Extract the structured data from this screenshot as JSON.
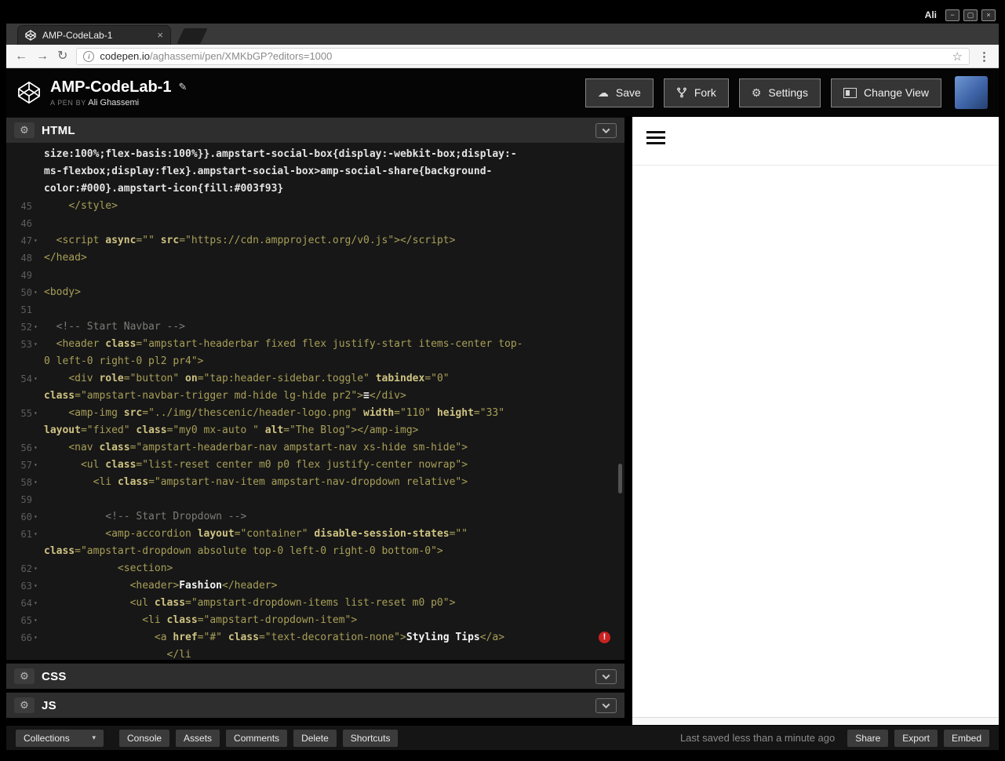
{
  "os": {
    "user": "Ali"
  },
  "icons": {
    "back": "←",
    "forward": "→",
    "reload": "↻",
    "info": "i",
    "star": "☆",
    "menu": "⋮",
    "close_tab": "×",
    "pencil": "✎",
    "gear": "⚙",
    "save_cloud": "☁",
    "caret_down": "▾",
    "error": "!",
    "minimize": "−",
    "maximize": "▢",
    "close": "×"
  },
  "browser": {
    "tab_title": "AMP-CodeLab-1",
    "url_host": "codepen.io",
    "url_path": "/aghassemi/pen/XMKbGP?editors=1000"
  },
  "header": {
    "title": "AMP-CodeLab-1",
    "byline_prefix": "A PEN BY",
    "author": "Ali Ghassemi",
    "buttons": [
      {
        "label": "Save"
      },
      {
        "label": "Fork"
      },
      {
        "label": "Settings"
      },
      {
        "label": "Change View"
      }
    ]
  },
  "editor": {
    "panels": {
      "html": "HTML",
      "css": "CSS",
      "js": "JS"
    },
    "rows": [
      {
        "segs": [
          [
            "pl",
            "size:100%;flex-basis:100%}}.ampstart-social-box{display:-webkit-box;display:-"
          ]
        ]
      },
      {
        "segs": [
          [
            "pl",
            "ms-flexbox;display:flex}.ampstart-social-box>amp-social-share{background-"
          ]
        ]
      },
      {
        "segs": [
          [
            "pl",
            "color:#000}.ampstart-icon{fill:#003f93}"
          ]
        ]
      },
      {
        "n": "45",
        "segs": [
          [
            "pl",
            "    "
          ],
          [
            "tg",
            "</style>"
          ]
        ]
      },
      {
        "n": "46",
        "segs": []
      },
      {
        "n": "47",
        "fold": true,
        "segs": [
          [
            "pl",
            "  "
          ],
          [
            "tg",
            "<script "
          ],
          [
            "at",
            "async"
          ],
          [
            "st",
            "=\"\" "
          ],
          [
            "at",
            "src"
          ],
          [
            "st",
            "=\"https://cdn.ampproject.org/v0.js\""
          ],
          [
            "tg",
            "></script>"
          ]
        ]
      },
      {
        "n": "48",
        "segs": [
          [
            "tg",
            "</head>"
          ]
        ]
      },
      {
        "n": "49",
        "segs": []
      },
      {
        "n": "50",
        "fold": true,
        "segs": [
          [
            "tg",
            "<body>"
          ]
        ]
      },
      {
        "n": "51",
        "segs": []
      },
      {
        "n": "52",
        "fold": true,
        "segs": [
          [
            "cm",
            "  <!-- Start Navbar -->"
          ]
        ]
      },
      {
        "n": "53",
        "fold": true,
        "segs": [
          [
            "pl",
            "  "
          ],
          [
            "tg",
            "<header "
          ],
          [
            "at",
            "class"
          ],
          [
            "st",
            "=\"ampstart-headerbar fixed flex justify-start items-center top-"
          ]
        ]
      },
      {
        "segs": [
          [
            "st",
            "0 left-0 right-0 pl2 pr4\""
          ],
          [
            "tg",
            ">"
          ]
        ]
      },
      {
        "n": "54",
        "fold": true,
        "segs": [
          [
            "pl",
            "    "
          ],
          [
            "tg",
            "<div "
          ],
          [
            "at",
            "role"
          ],
          [
            "st",
            "=\"button\" "
          ],
          [
            "at",
            "on"
          ],
          [
            "st",
            "=\"tap:header-sidebar.toggle\" "
          ],
          [
            "at",
            "tabindex"
          ],
          [
            "st",
            "=\"0\""
          ]
        ]
      },
      {
        "segs": [
          [
            "at",
            "class"
          ],
          [
            "st",
            "=\"ampstart-navbar-trigger md-hide lg-hide pr2\""
          ],
          [
            "tg",
            ">"
          ],
          [
            "tx",
            "≡"
          ],
          [
            "tg",
            "</div>"
          ]
        ]
      },
      {
        "n": "55",
        "fold": true,
        "segs": [
          [
            "pl",
            "    "
          ],
          [
            "tg",
            "<amp-img "
          ],
          [
            "at",
            "src"
          ],
          [
            "st",
            "=\"../img/thescenic/header-logo.png\" "
          ],
          [
            "at",
            "width"
          ],
          [
            "st",
            "=\"110\" "
          ],
          [
            "at",
            "height"
          ],
          [
            "st",
            "=\"33\""
          ]
        ]
      },
      {
        "segs": [
          [
            "at",
            "layout"
          ],
          [
            "st",
            "=\"fixed\" "
          ],
          [
            "at",
            "class"
          ],
          [
            "st",
            "=\"my0 mx-auto \" "
          ],
          [
            "at",
            "alt"
          ],
          [
            "st",
            "=\"The Blog\""
          ],
          [
            "tg",
            "></amp-img>"
          ]
        ]
      },
      {
        "n": "56",
        "fold": true,
        "segs": [
          [
            "pl",
            "    "
          ],
          [
            "tg",
            "<nav "
          ],
          [
            "at",
            "class"
          ],
          [
            "st",
            "=\"ampstart-headerbar-nav ampstart-nav xs-hide sm-hide\""
          ],
          [
            "tg",
            ">"
          ]
        ]
      },
      {
        "n": "57",
        "fold": true,
        "segs": [
          [
            "pl",
            "      "
          ],
          [
            "tg",
            "<ul "
          ],
          [
            "at",
            "class"
          ],
          [
            "st",
            "=\"list-reset center m0 p0 flex justify-center nowrap\""
          ],
          [
            "tg",
            ">"
          ]
        ]
      },
      {
        "n": "58",
        "fold": true,
        "segs": [
          [
            "pl",
            "        "
          ],
          [
            "tg",
            "<li "
          ],
          [
            "at",
            "class"
          ],
          [
            "st",
            "=\"ampstart-nav-item ampstart-nav-dropdown relative\""
          ],
          [
            "tg",
            ">"
          ]
        ]
      },
      {
        "n": "59",
        "segs": []
      },
      {
        "n": "60",
        "fold": true,
        "segs": [
          [
            "cm",
            "          <!-- Start Dropdown -->"
          ]
        ]
      },
      {
        "n": "61",
        "fold": true,
        "segs": [
          [
            "pl",
            "          "
          ],
          [
            "tg",
            "<amp-accordion "
          ],
          [
            "at",
            "layout"
          ],
          [
            "st",
            "=\"container\" "
          ],
          [
            "at",
            "disable-session-states"
          ],
          [
            "st",
            "=\"\""
          ]
        ]
      },
      {
        "segs": [
          [
            "at",
            "class"
          ],
          [
            "st",
            "=\"ampstart-dropdown absolute top-0 left-0 right-0 bottom-0\""
          ],
          [
            "tg",
            ">"
          ]
        ]
      },
      {
        "n": "62",
        "fold": true,
        "segs": [
          [
            "pl",
            "            "
          ],
          [
            "tg",
            "<section>"
          ]
        ]
      },
      {
        "n": "63",
        "fold": true,
        "segs": [
          [
            "pl",
            "              "
          ],
          [
            "tg",
            "<header>"
          ],
          [
            "tx",
            "Fashion"
          ],
          [
            "tg",
            "</header>"
          ]
        ]
      },
      {
        "n": "64",
        "fold": true,
        "segs": [
          [
            "pl",
            "              "
          ],
          [
            "tg",
            "<ul "
          ],
          [
            "at",
            "class"
          ],
          [
            "st",
            "=\"ampstart-dropdown-items list-reset m0 p0\""
          ],
          [
            "tg",
            ">"
          ]
        ]
      },
      {
        "n": "65",
        "fold": true,
        "segs": [
          [
            "pl",
            "                "
          ],
          [
            "tg",
            "<li "
          ],
          [
            "at",
            "class"
          ],
          [
            "st",
            "=\"ampstart-dropdown-item\""
          ],
          [
            "tg",
            ">"
          ]
        ]
      },
      {
        "n": "66",
        "fold": true,
        "error": true,
        "segs": [
          [
            "pl",
            "                  "
          ],
          [
            "tg",
            "<a "
          ],
          [
            "at",
            "href"
          ],
          [
            "st",
            "=\"#\" "
          ],
          [
            "at",
            "class"
          ],
          [
            "st",
            "=\"text-decoration-none\""
          ],
          [
            "tg",
            ">"
          ],
          [
            "tx",
            "Styling Tips"
          ],
          [
            "tg",
            "</a>"
          ]
        ]
      },
      {
        "segs": [
          [
            "pl",
            "                    "
          ],
          [
            "tg",
            "</li"
          ]
        ]
      }
    ]
  },
  "footer": {
    "collections_label": "Collections",
    "left_buttons": [
      "Console",
      "Assets",
      "Comments",
      "Delete",
      "Shortcuts"
    ],
    "status": "Last saved less than a minute ago",
    "right_buttons": [
      "Share",
      "Export",
      "Embed"
    ]
  }
}
